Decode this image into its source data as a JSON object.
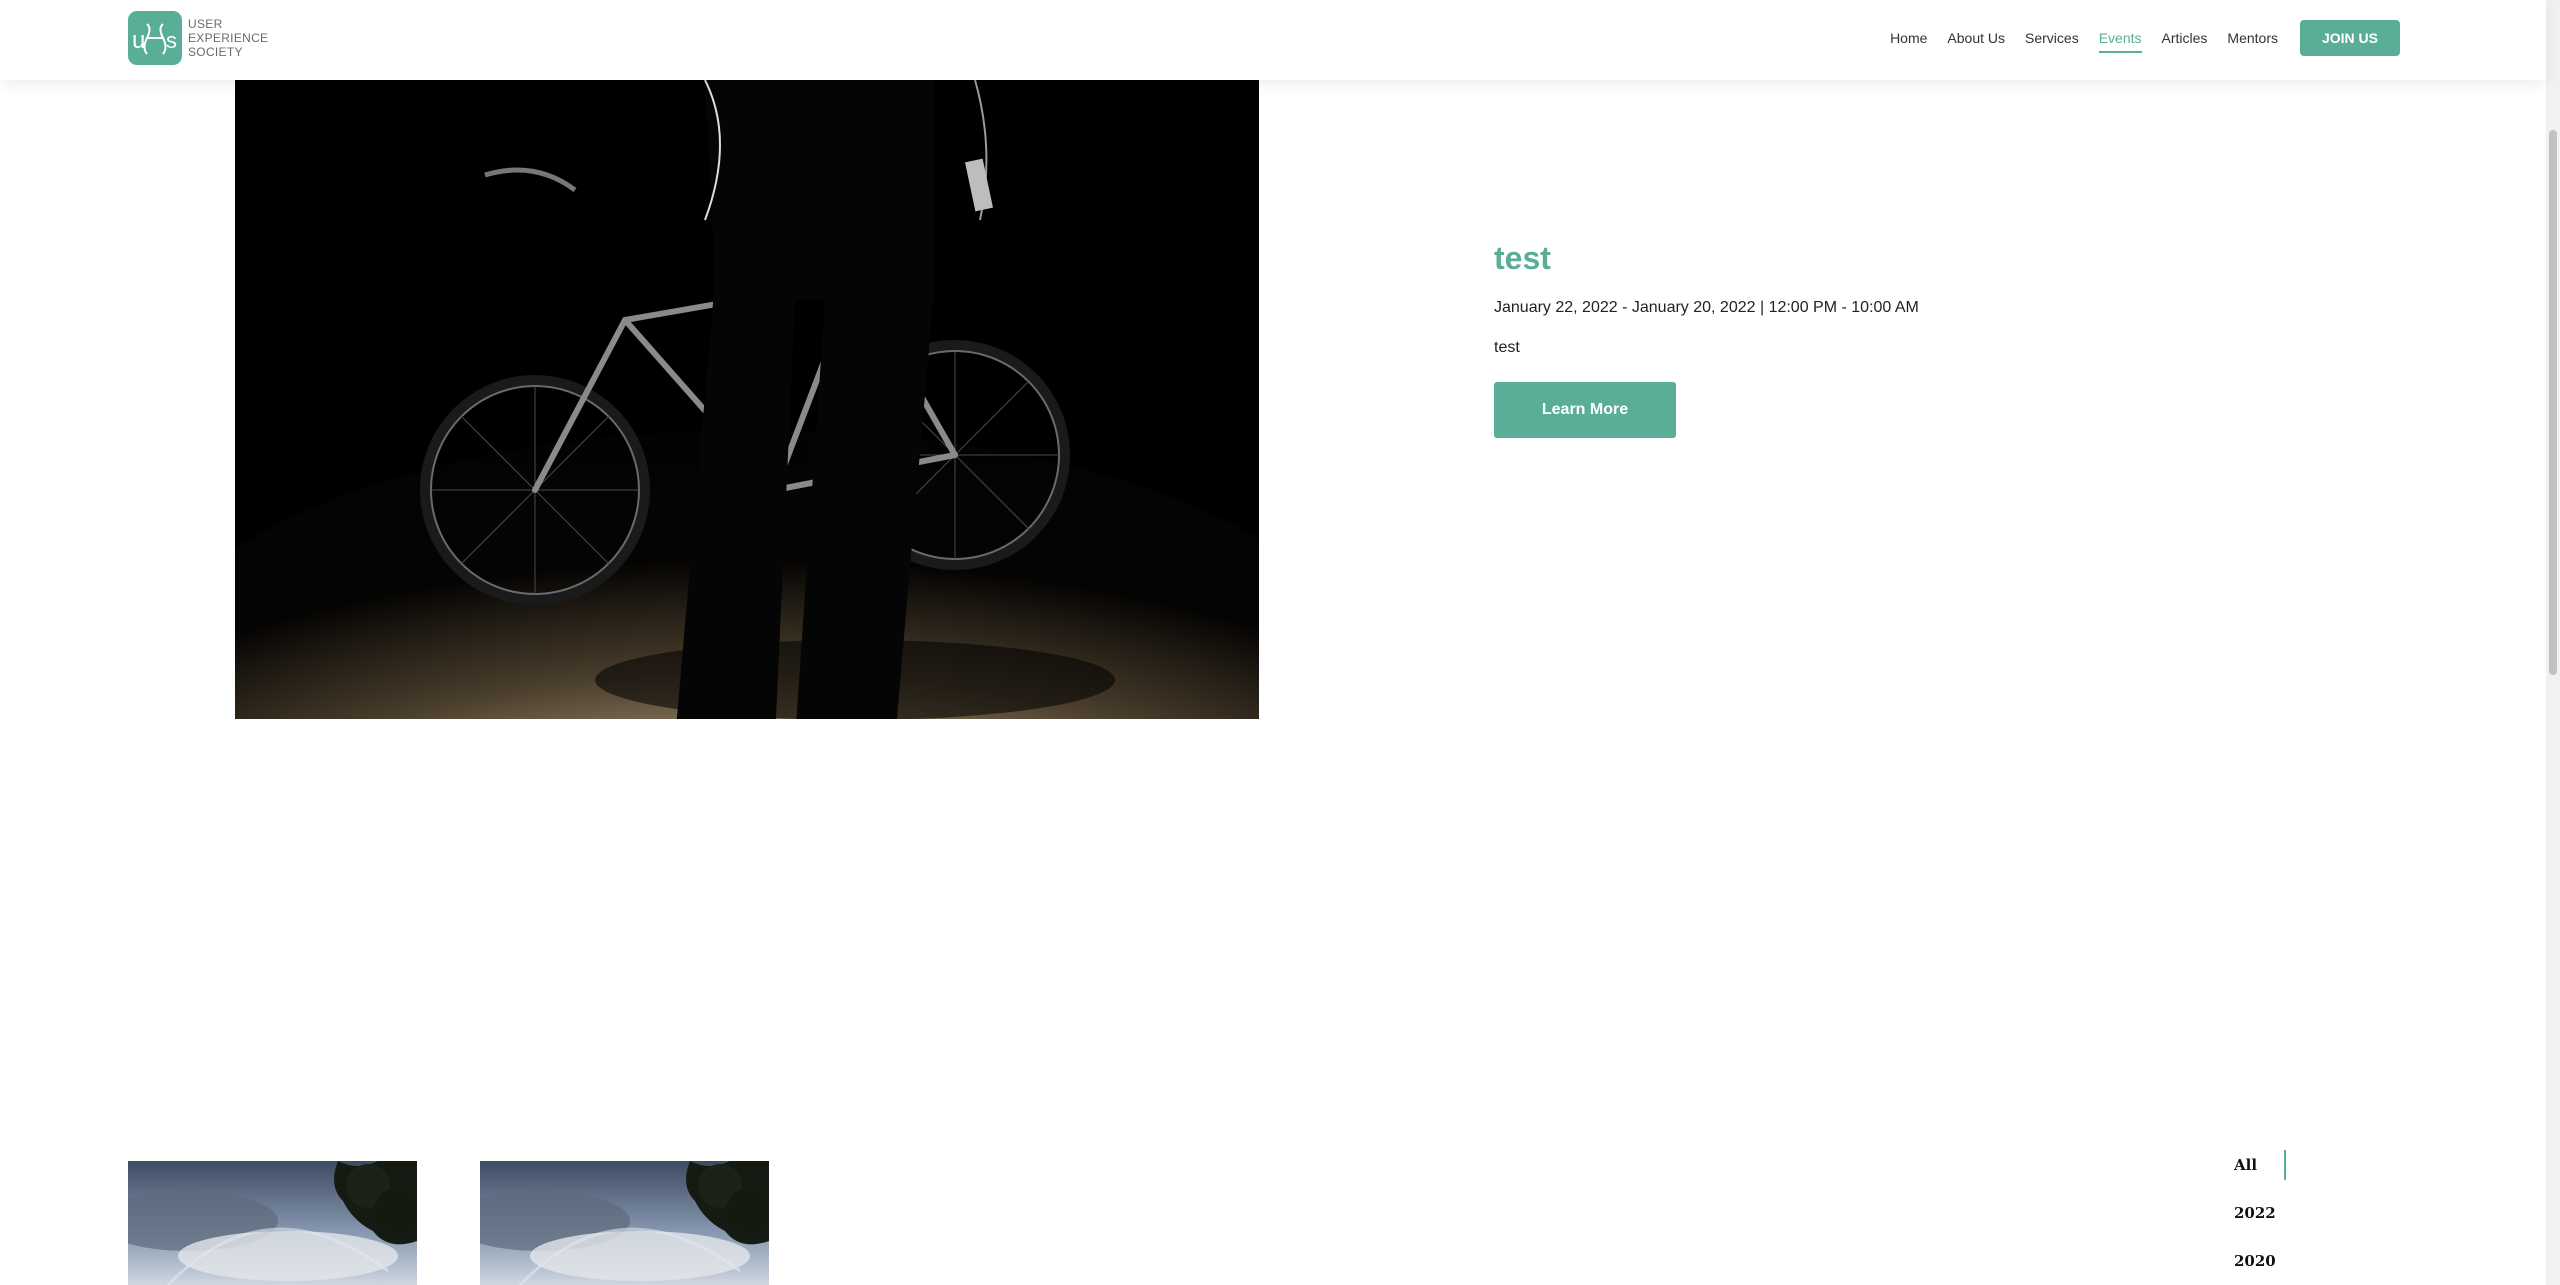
{
  "header": {
    "logo_lines": [
      "USER",
      "EXPERIENCE",
      "SOCIETY"
    ],
    "nav": [
      {
        "label": "Home"
      },
      {
        "label": "About Us"
      },
      {
        "label": "Services"
      },
      {
        "label": "Events"
      },
      {
        "label": "Articles"
      },
      {
        "label": "Mentors"
      }
    ],
    "active_nav": "Events",
    "join_label": "JOIN US"
  },
  "event": {
    "title": "test",
    "dates": "January 22, 2022 - January 20, 2022 | 12:00 PM - 10:00 AM",
    "description": "test",
    "learn_more_label": "Learn More"
  },
  "filters": [
    {
      "label": "All"
    },
    {
      "label": "2022"
    },
    {
      "label": "2020"
    }
  ],
  "active_filter": "All",
  "colors": {
    "accent": "#5aad96",
    "text": "#222222",
    "background": "#ffffff"
  },
  "icons": [
    "uxs-logo-icon"
  ]
}
